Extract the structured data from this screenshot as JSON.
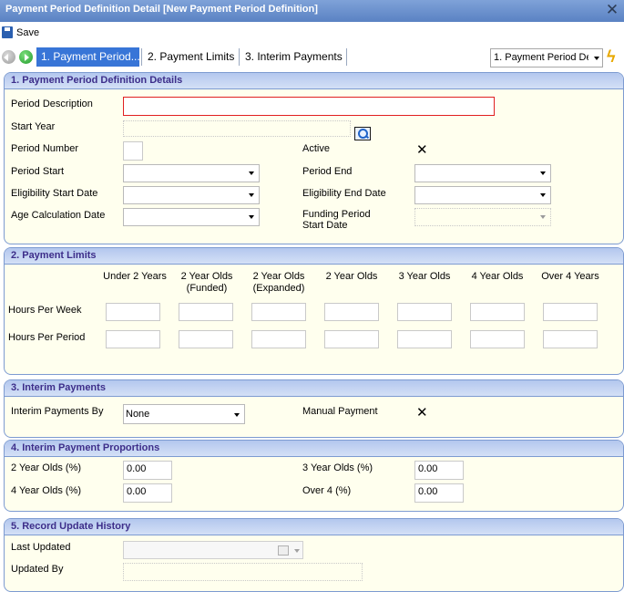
{
  "window": {
    "title": "Payment Period Definition Detail [New Payment Period Definition]"
  },
  "toolbar": {
    "save_label": "Save"
  },
  "tabs": [
    {
      "label": "1. Payment Period..."
    },
    {
      "label": "2. Payment Limits"
    },
    {
      "label": "3. Interim Payments"
    }
  ],
  "jump": {
    "value": "1. Payment Period De"
  },
  "section1": {
    "title": "1. Payment Period Definition Details",
    "period_description": "Period Description",
    "start_year": "Start Year",
    "period_number": "Period Number",
    "active": "Active",
    "period_start": "Period Start",
    "period_end": "Period End",
    "eligibility_start": "Eligibility Start Date",
    "eligibility_end": "Eligibility End Date",
    "age_calc": "Age Calculation Date",
    "funding_start_l1": "Funding Period",
    "funding_start_l2": "Start Date"
  },
  "section2": {
    "title": "2. Payment Limits",
    "columns": [
      {
        "l1": "Under 2 Years",
        "l2": ""
      },
      {
        "l1": "2 Year Olds",
        "l2": "(Funded)"
      },
      {
        "l1": "2 Year Olds",
        "l2": "(Expanded)"
      },
      {
        "l1": "2 Year Olds",
        "l2": ""
      },
      {
        "l1": "3 Year Olds",
        "l2": ""
      },
      {
        "l1": "4 Year Olds",
        "l2": ""
      },
      {
        "l1": "Over 4 Years",
        "l2": ""
      }
    ],
    "rows": {
      "hours_per_week": "Hours Per Week",
      "hours_per_period": "Hours Per Period"
    }
  },
  "section3": {
    "title": "3. Interim Payments",
    "interim_by": "Interim Payments By",
    "interim_by_value": "None",
    "manual_payment": "Manual Payment"
  },
  "section4": {
    "title": "4. Interim Payment Proportions",
    "two_year": "2 Year Olds (%)",
    "two_year_value": "0.00",
    "three_year": "3 Year Olds (%)",
    "three_year_value": "0.00",
    "four_year": "4 Year Olds (%)",
    "four_year_value": "0.00",
    "over4": "Over 4 (%)",
    "over4_value": "0.00"
  },
  "section5": {
    "title": "5. Record Update History",
    "last_updated": "Last Updated",
    "updated_by": "Updated By"
  },
  "colors": {
    "accent": "#3875d7",
    "panel_bg": "#ffffee",
    "header_text": "#3d2e8a",
    "required_border": "#e02020"
  }
}
